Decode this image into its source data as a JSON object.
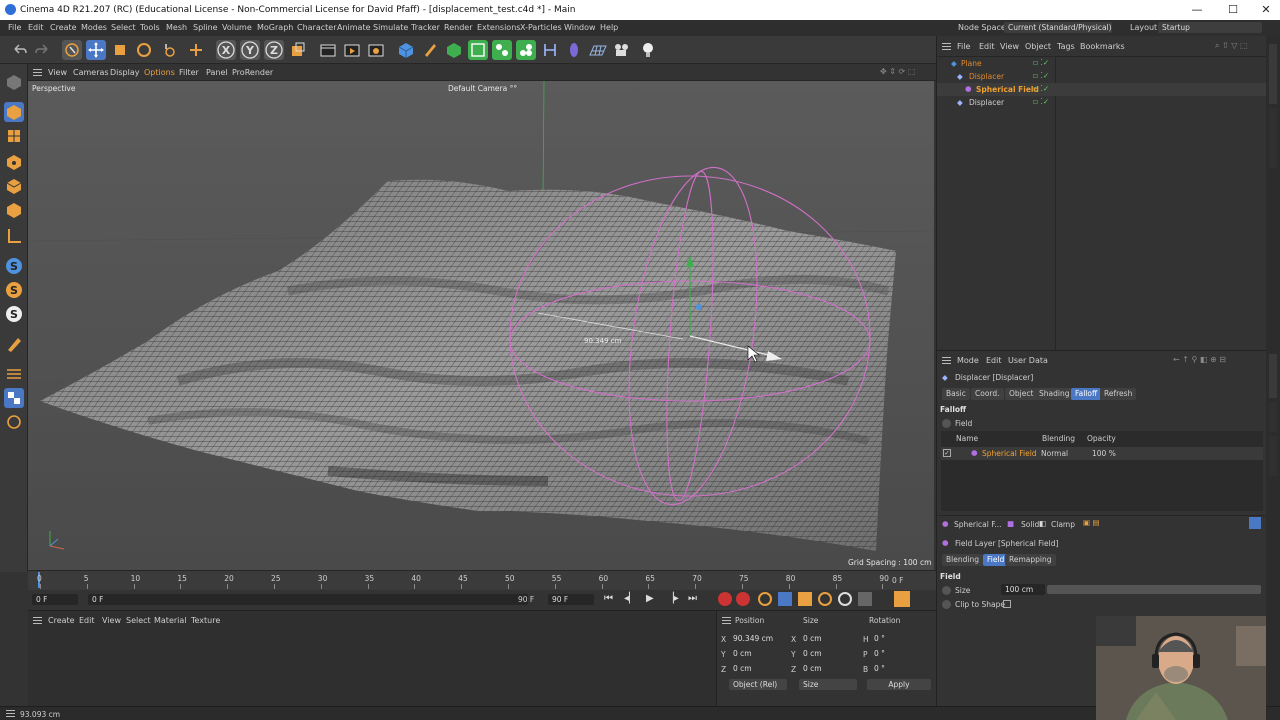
{
  "window": {
    "title": "Cinema 4D R21.207 (RC) (Educational License - Non-Commercial License for David Pfaff) - [displacement_test.c4d *] - Main",
    "controls": [
      "—",
      "☐",
      "✕"
    ]
  },
  "menubar": {
    "items": [
      "File",
      "Edit",
      "Create",
      "Modes",
      "Select",
      "Tools",
      "Mesh",
      "Spline",
      "Volume",
      "MoGraph",
      "Character",
      "Animate",
      "Simulate",
      "Tracker",
      "Render",
      "Extensions",
      "X-Particles",
      "Window",
      "Help"
    ],
    "node_space_label": "Node Space:",
    "node_space_value": "Current (Standard/Physical)",
    "layout_label": "Layout:",
    "layout_value": "Startup"
  },
  "toolbar": {
    "axis_labels": [
      "X",
      "Y",
      "Z"
    ]
  },
  "viewport": {
    "menu": [
      "View",
      "Cameras",
      "Display",
      "Options",
      "Filter",
      "Panel",
      "ProRender"
    ],
    "view_name": "Perspective",
    "camera": "Default Camera °°",
    "measure": "90.349 cm",
    "grid_spacing": "Grid Spacing : 100 cm"
  },
  "timeline": {
    "ticks": [
      "0",
      "5",
      "10",
      "15",
      "20",
      "25",
      "30",
      "35",
      "40",
      "45",
      "50",
      "55",
      "60",
      "65",
      "70",
      "75",
      "80",
      "85",
      "90"
    ],
    "end_label": "0 F",
    "current_frame": "0 F",
    "start_field": "0 F",
    "end_field": "90 F",
    "end_field2": "90 F"
  },
  "material_manager": {
    "menu": [
      "Create",
      "Edit",
      "View",
      "Select",
      "Material",
      "Texture"
    ]
  },
  "coordinates": {
    "headers": [
      "Position",
      "Size",
      "Rotation"
    ],
    "rows": [
      {
        "axis": "X",
        "pos": "90.349 cm",
        "size_axis": "X",
        "size": "0 cm",
        "rot_axis": "H",
        "rot": "0 °"
      },
      {
        "axis": "Y",
        "pos": "0 cm",
        "size_axis": "Y",
        "size": "0 cm",
        "rot_axis": "P",
        "rot": "0 °"
      },
      {
        "axis": "Z",
        "pos": "0 cm",
        "size_axis": "Z",
        "size": "0 cm",
        "rot_axis": "B",
        "rot": "0 °"
      }
    ],
    "mode": "Object (Rel)",
    "size_mode": "Size",
    "apply": "Apply"
  },
  "status": {
    "text": "93.093 cm"
  },
  "object_manager": {
    "menu": [
      "File",
      "Edit",
      "View",
      "Object",
      "Tags",
      "Bookmarks"
    ],
    "objects": [
      {
        "name": "Plane",
        "color": "#e08a2e"
      },
      {
        "name": "Displacer",
        "color": "#e08a2e"
      },
      {
        "name": "Spherical Field",
        "color": "#f0a030"
      },
      {
        "name": "Displacer",
        "color": "#d0d0d0"
      }
    ]
  },
  "attribute_manager": {
    "menu": [
      "Mode",
      "Edit",
      "User Data"
    ],
    "object_title": "Displacer [Displacer]",
    "tabs": [
      "Basic",
      "Coord.",
      "Object",
      "Shading",
      "Falloff",
      "Refresh"
    ],
    "active_tab": "Falloff",
    "section": "Falloff",
    "field_label": "Field",
    "columns": [
      "Name",
      "Blending",
      "Opacity"
    ],
    "layer": {
      "name": "Spherical Field",
      "blending": "Normal",
      "opacity": "100 %"
    },
    "layer_toolbar": [
      "Spherical F...",
      "Solid",
      "Clamp"
    ],
    "layer_title": "Field Layer [Spherical Field]",
    "layer_tabs": [
      "Blending",
      "Field",
      "Remapping"
    ],
    "layer_active_tab": "Field",
    "layer_section": "Field",
    "size_label": "Size",
    "size_value": "100 cm",
    "clip_label": "Clip to Shape"
  },
  "colors": {
    "accent": "#4a78c4",
    "field_sphere": "#d070c8",
    "selection": "#f0a030"
  }
}
